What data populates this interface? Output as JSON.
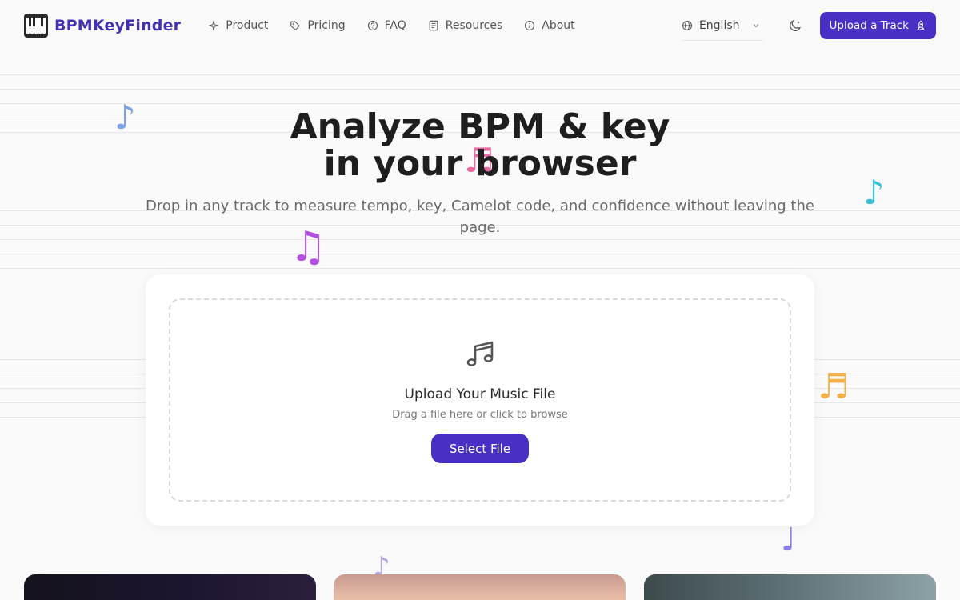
{
  "brand": {
    "name": "BPMKeyFinder",
    "accent": "#4a2fc4",
    "logo_color": "#4530b0"
  },
  "nav": {
    "items": [
      {
        "label": "Product",
        "icon": "sparkle-icon"
      },
      {
        "label": "Pricing",
        "icon": "tag-icon"
      },
      {
        "label": "FAQ",
        "icon": "help-circle-icon"
      },
      {
        "label": "Resources",
        "icon": "document-icon"
      },
      {
        "label": "About",
        "icon": "info-icon"
      }
    ]
  },
  "header": {
    "language": "English",
    "upload_label": "Upload a Track"
  },
  "hero": {
    "title_line1": "Analyze BPM & key",
    "title_line2": "in your browser",
    "subtitle": "Drop in any track to measure tempo, key, Camelot code, and confidence without leaving the page."
  },
  "upload": {
    "title": "Upload Your Music File",
    "hint": "Drag a file here or click to browse",
    "button": "Select File"
  },
  "notes": {
    "n1": {
      "glyph": "♪",
      "color": "#7aa3e8"
    },
    "n2": {
      "glyph": "♬",
      "color": "#e86aa0"
    },
    "n3": {
      "glyph": "♪",
      "color": "#3cc0d8"
    },
    "n4": {
      "glyph": "♫",
      "color": "#b44fe0"
    },
    "n5": {
      "glyph": "♬",
      "color": "#f2b24a"
    },
    "n6": {
      "glyph": "♩",
      "color": "#8a7de8"
    },
    "n7": {
      "glyph": "♪",
      "color": "#b9a6e6"
    }
  }
}
